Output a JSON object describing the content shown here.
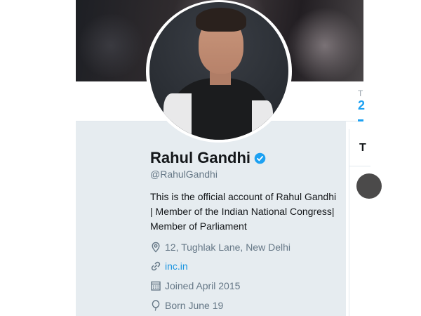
{
  "profile": {
    "name": "Rahul Gandhi",
    "handle": "@RahulGandhi",
    "bio": "This is the official account of Rahul Gandhi | Member of the Indian National Congress| Member of Parliament",
    "location": "12, Tughlak Lane, New Delhi",
    "website": "inc.in",
    "joined": "Joined April 2015",
    "born": "Born June 19"
  },
  "peek": {
    "stat_label_fragment": "T",
    "stat_value_fragment": "2",
    "right_col_heading_fragment": "T"
  },
  "icons": {
    "verified": "verified-badge-icon",
    "location": "location-pin-icon",
    "link": "link-icon",
    "calendar": "calendar-icon",
    "balloon": "birthday-balloon-icon"
  },
  "colors": {
    "accent": "#1da1f2",
    "link": "#1b95e0",
    "card_bg": "#e6ecf0",
    "muted_text": "#657786",
    "primary_text": "#14171a"
  }
}
